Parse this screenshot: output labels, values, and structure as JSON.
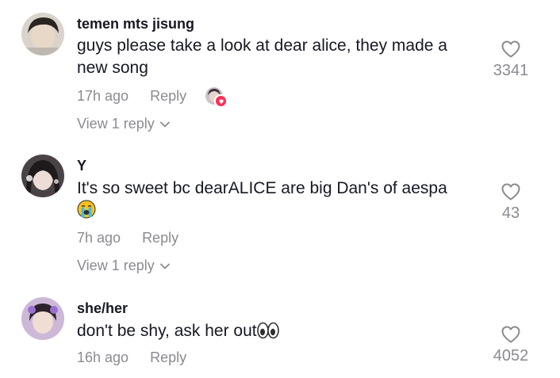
{
  "comments": [
    {
      "username": "temen mts jisung",
      "text": "guys please take a look at dear alice, they made a new song",
      "time": "17h ago",
      "reply_label": "Reply",
      "view_replies": "View 1 reply",
      "likes": "3341",
      "liked_by_creator": true
    },
    {
      "username": "Y",
      "text": "It's so sweet bc dearALICE are big Dan's of aespa",
      "emoji": "loudly-crying-face",
      "time": "7h ago",
      "reply_label": "Reply",
      "view_replies": "View 1 reply",
      "likes": "43"
    },
    {
      "username": "she/her",
      "text": "don't be shy, ask her out",
      "emoji": "eyes",
      "time": "16h ago",
      "reply_label": "Reply",
      "likes": "4052"
    }
  ],
  "colors": {
    "text": "#161823",
    "muted": "#8a8b91",
    "accent": "#fe2c55"
  },
  "icons": [
    "heart-outline-icon",
    "chevron-down-icon",
    "creator-liked-badge-icon"
  ]
}
